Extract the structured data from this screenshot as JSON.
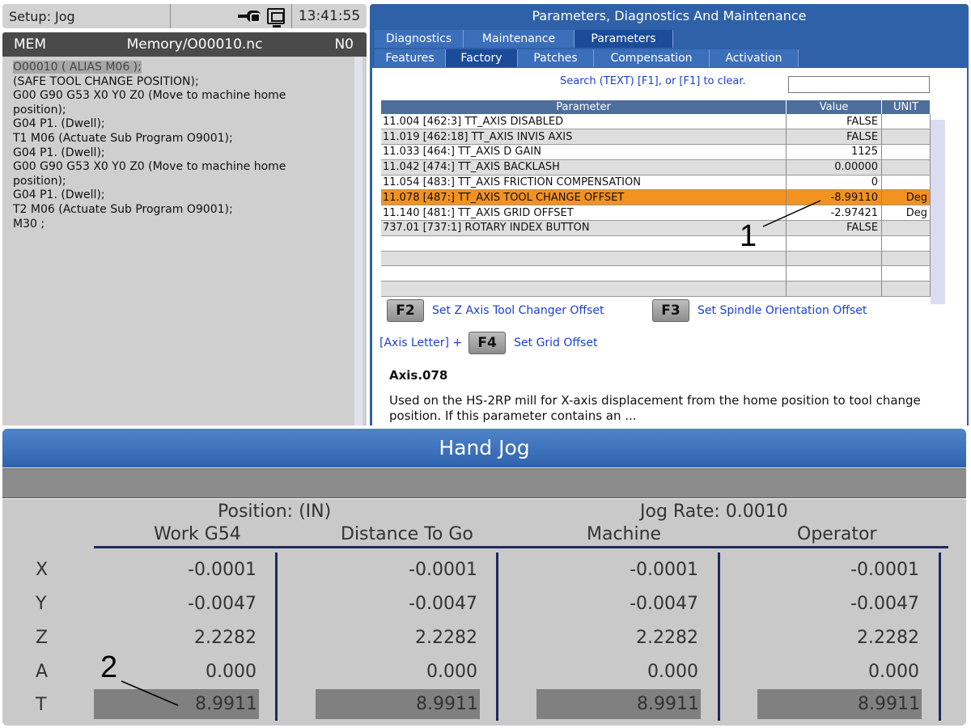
{
  "status": {
    "mode": "Setup: Jog",
    "clock": "13:41:55"
  },
  "program": {
    "mode": "MEM",
    "file": "Memory/O00010.nc",
    "line": "N0",
    "lines": [
      "O00010 ( ALIAS M06 );",
      "(SAFE TOOL CHANGE POSITION);",
      "G00 G90 G53 X0 Y0 Z0 (Move to machine home",
      "position);",
      "G04 P1. (Dwell);",
      "T1 M06 (Actuate Sub Program O9001);",
      "G04 P1. (Dwell);",
      "G00 G90 G53 X0 Y0 Z0 (Move to machine home",
      "position);",
      "G04 P1. (Dwell);",
      "T2 M06 (Actuate Sub Program O9001);",
      "M30 ;"
    ]
  },
  "params": {
    "title": "Parameters, Diagnostics And Maintenance",
    "tabs1": [
      "Diagnostics",
      "Maintenance",
      "Parameters"
    ],
    "tabs2": [
      "Features",
      "Factory",
      "Patches",
      "Compensation",
      "Activation"
    ],
    "search_label": "Search (TEXT) [F1], or [F1] to clear.",
    "headers": {
      "param": "Parameter",
      "value": "Value",
      "unit": "UNIT"
    },
    "rows": [
      {
        "param": "11.004 [462:3] TT_AXIS DISABLED",
        "value": "FALSE",
        "unit": ""
      },
      {
        "param": "11.019 [462:18]  TT_AXIS INVIS AXIS",
        "value": "FALSE",
        "unit": ""
      },
      {
        "param": "11.033 [464:] TT_AXIS D GAIN",
        "value": "1125",
        "unit": ""
      },
      {
        "param": "11.042 [474:]  TT_AXIS BACKLASH",
        "value": "0.00000",
        "unit": ""
      },
      {
        "param": "11.054 [483:]  TT_AXIS FRICTION COMPENSATION",
        "value": "0",
        "unit": ""
      },
      {
        "param": "11.078 [487:]  TT_AXIS TOOL CHANGE OFFSET",
        "value": "-8.99110",
        "unit": "Deg"
      },
      {
        "param": "11.140 [481:]  TT_AXIS GRID OFFSET",
        "value": "-2.97421",
        "unit": "Deg"
      },
      {
        "param": "737.01 [737:1]  ROTARY INDEX BUTTON",
        "value": "FALSE",
        "unit": ""
      },
      {
        "param": "",
        "value": "",
        "unit": ""
      },
      {
        "param": "",
        "value": "",
        "unit": ""
      },
      {
        "param": "",
        "value": "",
        "unit": ""
      },
      {
        "param": "",
        "value": "",
        "unit": ""
      }
    ],
    "f2_key": "F2",
    "f2_label": "Set Z Axis Tool Changer Offset",
    "f3_key": "F3",
    "f3_label": "Set Spindle Orientation Offset",
    "f4_prefix": "[Axis Letter] +",
    "f4_key": "F4",
    "f4_label": "Set Grid Offset",
    "desc_title": "Axis.078",
    "desc_text": "Used on the HS-2RP mill for X-axis displacement from the home position to tool change position. If this parameter contains an ..."
  },
  "callouts": {
    "one": "1",
    "two": "2"
  },
  "jog": {
    "title": "Hand Jog",
    "position_label": "Position: (IN)",
    "jog_rate": "Jog Rate: 0.0010",
    "columns": [
      "Work G54",
      "Distance To Go",
      "Machine",
      "Operator"
    ],
    "axes": [
      {
        "axis": "X",
        "values": [
          "-0.0001",
          "-0.0001",
          "-0.0001",
          "-0.0001"
        ]
      },
      {
        "axis": "Y",
        "values": [
          "-0.0047",
          "-0.0047",
          "-0.0047",
          "-0.0047"
        ]
      },
      {
        "axis": "Z",
        "values": [
          "2.2282",
          "2.2282",
          "2.2282",
          "2.2282"
        ]
      },
      {
        "axis": "A",
        "values": [
          "0.000",
          "0.000",
          "0.000",
          "0.000"
        ]
      },
      {
        "axis": "T",
        "values": [
          "8.9911",
          "8.9911",
          "8.9911",
          "8.9911"
        ]
      }
    ]
  }
}
